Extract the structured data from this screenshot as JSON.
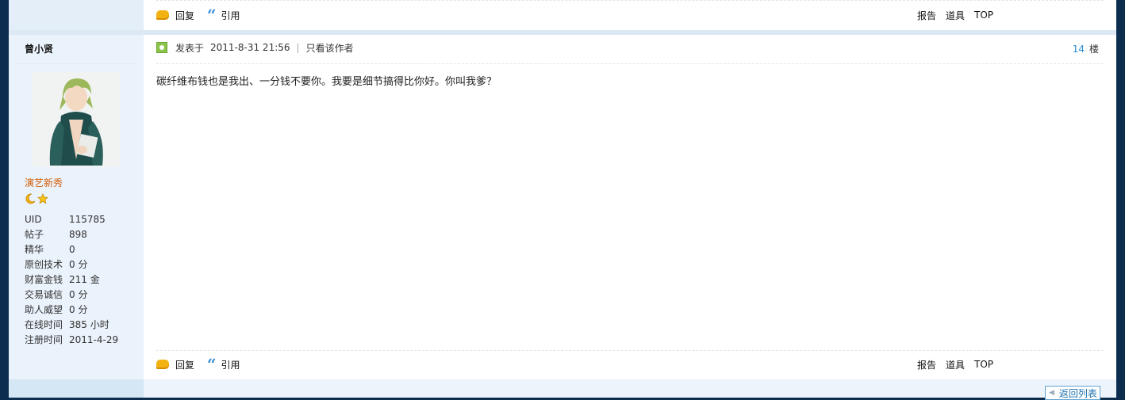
{
  "prev_post": {
    "actions": {
      "reply": "回复",
      "quote": "引用"
    },
    "links": {
      "report": "报告",
      "tools": "道具",
      "top": "TOP"
    }
  },
  "author": {
    "name": "曾小贤",
    "rank": "演艺新秀",
    "stats": [
      {
        "label": "UID",
        "value": "115785"
      },
      {
        "label": "帖子",
        "value": "898"
      },
      {
        "label": "精华",
        "value": "0"
      },
      {
        "label": "原创技术",
        "value": "0 分"
      },
      {
        "label": "财富金钱",
        "value": "211 金"
      },
      {
        "label": "交易诚信",
        "value": "0 分"
      },
      {
        "label": "助人威望",
        "value": "0 分"
      },
      {
        "label": "在线时间",
        "value": "385 小时"
      },
      {
        "label": "注册时间",
        "value": "2011-4-29"
      }
    ]
  },
  "post": {
    "posted_at_label": "发表于",
    "posted_at": "2011-8-31 21:56",
    "only_author": "只看该作者",
    "floor_num": "14",
    "floor_label": "楼",
    "content": "碳纤维布钱也是我出、一分钱不要你。我要是细节搞得比你好。你叫我爹？",
    "actions": {
      "reply": "回复",
      "quote": "引用"
    },
    "links": {
      "report": "报告",
      "tools": "道具",
      "top": "TOP"
    }
  },
  "footer": {
    "back_to_list": "返回列表"
  },
  "colors": {
    "accent": "#2a8bd3",
    "rank": "#d35f0b",
    "page_bg": "#0d2d4f"
  }
}
